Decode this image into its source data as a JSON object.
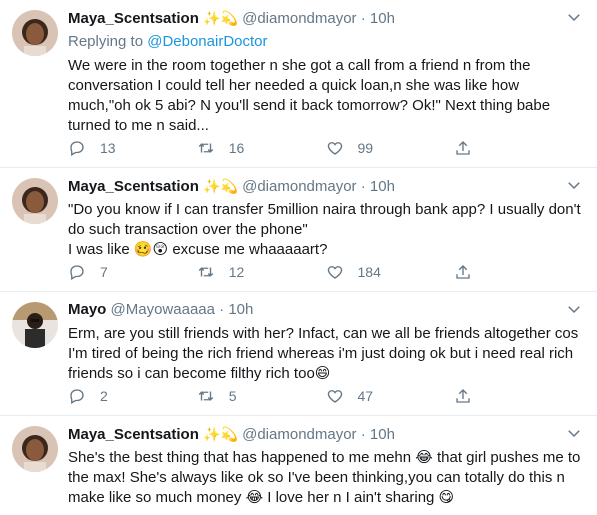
{
  "tweets": [
    {
      "name": "Maya_Scentsation",
      "name_emoji": "✨💫",
      "handle": "@diamondmayor",
      "separator": "·",
      "time": "10h",
      "replying_prefix": "Replying to",
      "replying_to": "@DebonairDoctor",
      "text": "We were in the room together n she got a call from a friend n from the conversation I could tell her needed a quick loan,n she was like how much,\"oh ok 5 abi? N you'll send it back tomorrow? Ok!\" Next thing babe turned to me n said...",
      "replies": "13",
      "retweets": "16",
      "likes": "99"
    },
    {
      "name": "Maya_Scentsation",
      "name_emoji": "✨💫",
      "handle": "@diamondmayor",
      "separator": "·",
      "time": "10h",
      "text": "\"Do you know if I can transfer 5million naira through bank app? I usually don't do such transaction over the phone\"\nI was like 🥴😲 excuse me whaaaaart?",
      "replies": "7",
      "retweets": "12",
      "likes": "184"
    },
    {
      "name": "Mayo",
      "handle": "@Mayowaaaaa",
      "separator": "·",
      "time": "10h",
      "text": "Erm, are you still friends with her? Infact, can we all be friends altogether cos I'm tired of being the rich friend whereas i'm just doing ok but i need real rich friends so i can become filthy rich too😄",
      "replies": "2",
      "retweets": "5",
      "likes": "47"
    },
    {
      "name": "Maya_Scentsation",
      "name_emoji": "✨💫",
      "handle": "@diamondmayor",
      "separator": "·",
      "time": "10h",
      "text": "She's the best thing that has happened to me mehn 😂 that girl pushes me to the max! She's always like ok so I've been thinking,you can totally do this n make like so much money 😂 I love her n I ain't sharing 😋"
    }
  ],
  "icons": {
    "reply": "reply-icon",
    "retweet": "retweet-icon",
    "like": "heart-icon",
    "share": "share-icon",
    "more": "chevron-down-icon"
  },
  "colors": {
    "link": "#1b95e0",
    "secondary_text": "#657786",
    "divider": "#e6ecf0"
  }
}
